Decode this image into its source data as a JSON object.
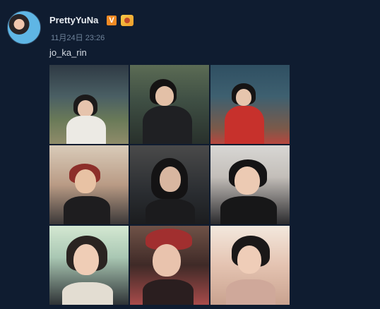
{
  "post": {
    "username": "PrettyYuNa",
    "vip_badge": "V",
    "timestamp": "11月24日 23:26",
    "text": "jo_ka_rin"
  },
  "icons": {
    "avatar": "avatar",
    "vip": "verified-badge-icon",
    "level": "member-level-icon"
  },
  "photos": [
    {
      "name": "photo-1"
    },
    {
      "name": "photo-2"
    },
    {
      "name": "photo-3"
    },
    {
      "name": "photo-4"
    },
    {
      "name": "photo-5"
    },
    {
      "name": "photo-6"
    },
    {
      "name": "photo-7"
    },
    {
      "name": "photo-8"
    },
    {
      "name": "photo-9"
    }
  ],
  "colors": {
    "background": "#0f1c30",
    "username": "#e9edf2",
    "timestamp": "#6f839a",
    "vip_badge": "#f08a24"
  }
}
